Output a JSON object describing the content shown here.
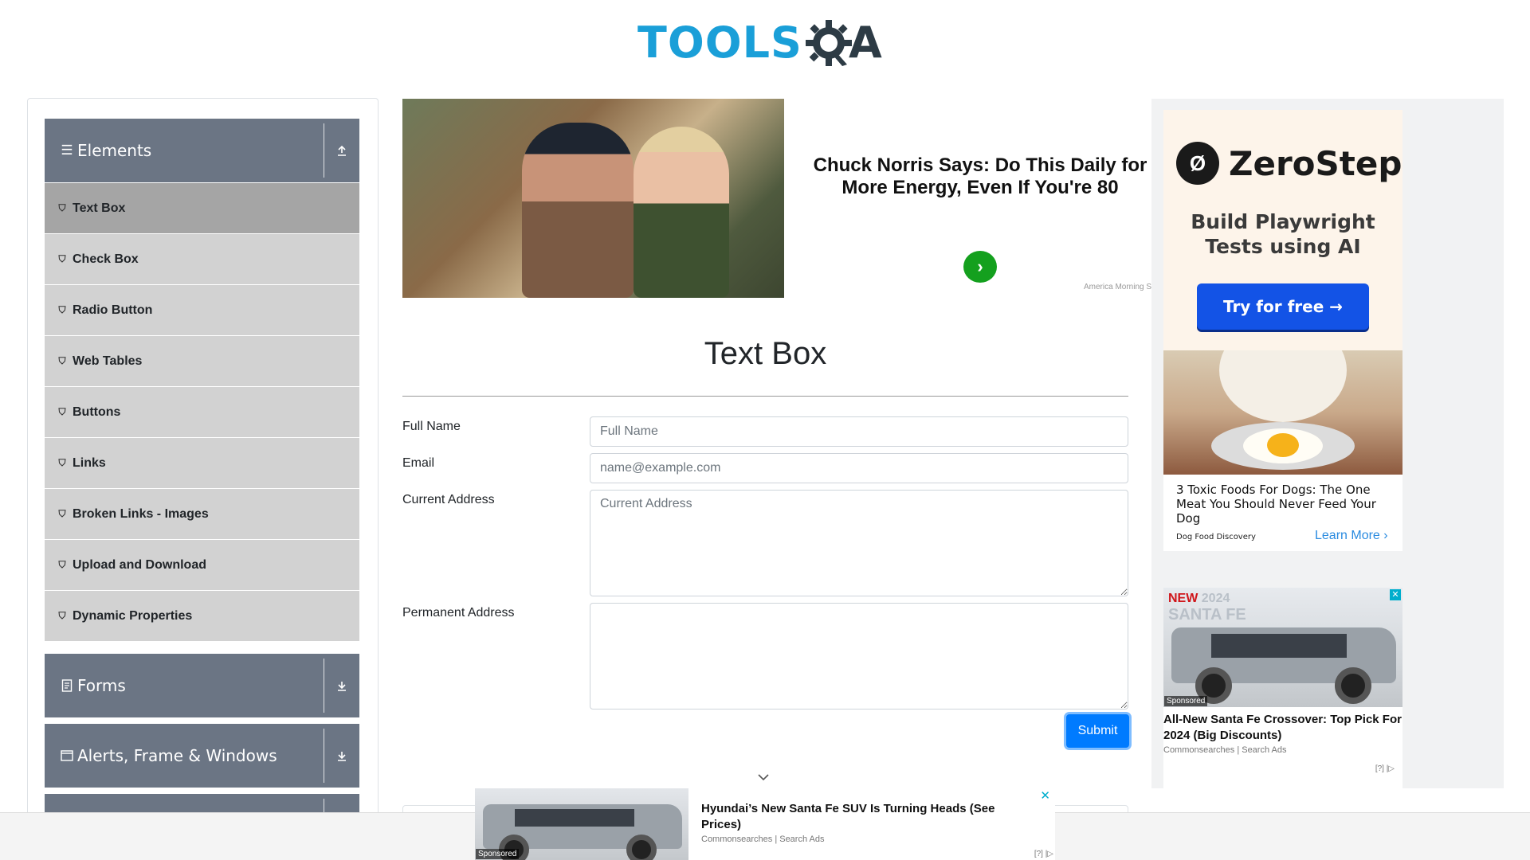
{
  "header": {
    "logo_text": "TOOLS",
    "logo_suffix": "A"
  },
  "sidebar": {
    "groups": [
      {
        "label": "Elements",
        "icon": "hamburger-icon",
        "arrow": "upload-icon"
      },
      {
        "label": "Forms",
        "icon": "document-icon",
        "arrow": "download-icon"
      },
      {
        "label": "Alerts, Frame & Windows",
        "icon": "window-icon",
        "arrow": "download-icon"
      }
    ],
    "items": [
      {
        "label": "Text Box",
        "active": true
      },
      {
        "label": "Check Box"
      },
      {
        "label": "Radio Button"
      },
      {
        "label": "Web Tables"
      },
      {
        "label": "Buttons"
      },
      {
        "label": "Links"
      },
      {
        "label": "Broken Links - Images"
      },
      {
        "label": "Upload and Download"
      },
      {
        "label": "Dynamic Properties"
      }
    ]
  },
  "top_ad": {
    "headline": "Chuck Norris Says: Do This Daily for More Energy, Even If You're 80",
    "source": "America Morning S",
    "button_icon": "chevron-right-icon",
    "button_color": "#14a01e"
  },
  "main": {
    "title": "Text Box",
    "fields": {
      "full_name": {
        "label": "Full Name",
        "placeholder": "Full Name"
      },
      "email": {
        "label": "Email",
        "placeholder": "name@example.com"
      },
      "current_address": {
        "label": "Current Address",
        "placeholder": "Current Address"
      },
      "permanent_address": {
        "label": "Permanent Address",
        "placeholder": ""
      }
    },
    "submit_label": "Submit",
    "accent": "#007bff"
  },
  "right_ads": {
    "zerostep": {
      "name": "ZeroStep",
      "tagline": "Build Playwright Tests using AI",
      "cta": "Try for free →"
    },
    "dog": {
      "title": "3 Toxic Foods For Dogs: The One Meat You Should Never Feed Your Dog",
      "source": "Dog Food Discovery",
      "cta": "Learn More ›"
    },
    "car": {
      "badge_new": "NEW",
      "badge_year": "2024",
      "badge_model": "SANTA FE",
      "sponsored": "Sponsored",
      "title": "All-New Santa Fe Crossover: Top Pick For 2024 (Big Discounts)",
      "source": "Commonsearches | Search Ads",
      "adchoice": "[?] |▷"
    }
  },
  "bottom_ad": {
    "title": "Hyundai’s New Santa Fe SUV Is Turning Heads (See Prices)",
    "source": "Commonsearches | Search Ads",
    "sponsored": "Sponsored",
    "adchoice": "[?] |▷"
  }
}
